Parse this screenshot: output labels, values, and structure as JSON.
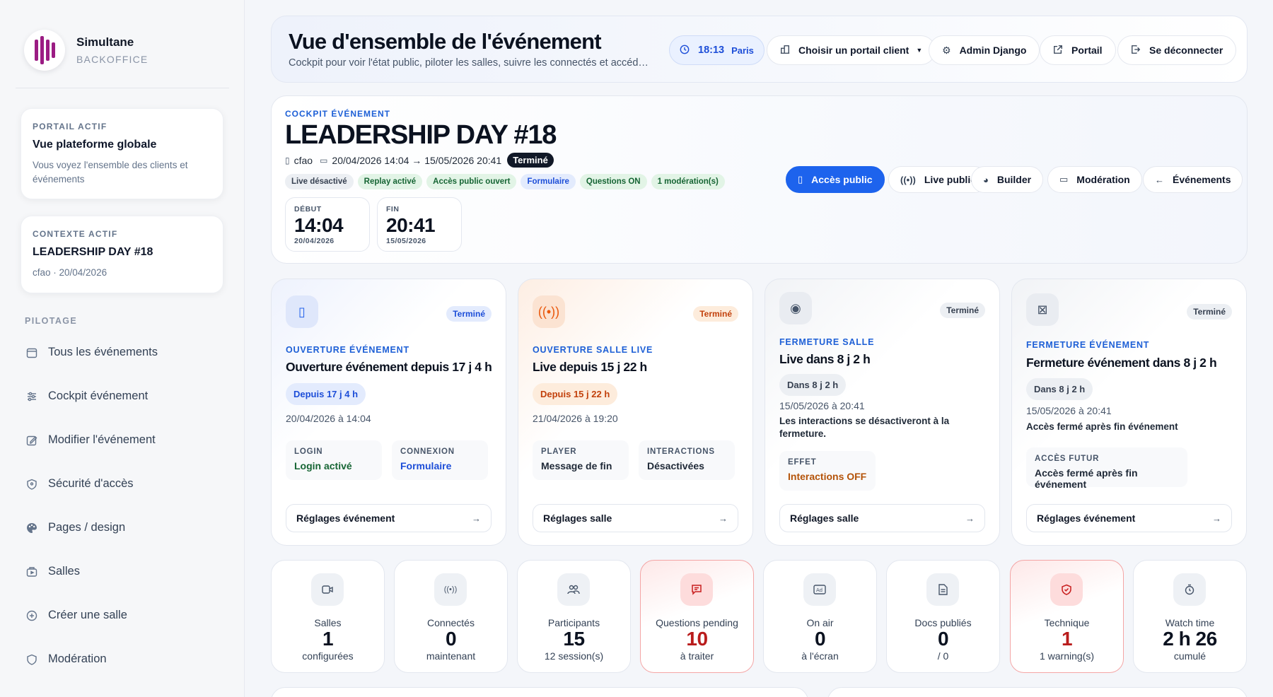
{
  "brand": {
    "name": "Simultane",
    "sub": "BACKOFFICE"
  },
  "portal_card": {
    "kicker": "PORTAIL ACTIF",
    "title": "Vue plateforme globale",
    "desc": "Vous voyez l'ensemble des clients et événements"
  },
  "context_card": {
    "kicker": "CONTEXTE ACTIF",
    "title": "LEADERSHIP DAY #18",
    "desc": "cfao · 20/04/2026"
  },
  "nav": {
    "heading": "PILOTAGE",
    "items": [
      {
        "label": "Tous les événements",
        "icon": "calendar-icon"
      },
      {
        "label": "Cockpit événement",
        "icon": "sliders-icon"
      },
      {
        "label": "Modifier l'événement",
        "icon": "edit-icon"
      },
      {
        "label": "Sécurité d'accès",
        "icon": "shield-icon"
      },
      {
        "label": "Pages / design",
        "icon": "palette-icon"
      },
      {
        "label": "Salles",
        "icon": "rooms-icon"
      },
      {
        "label": "Créer une salle",
        "icon": "plus-circle-icon"
      },
      {
        "label": "Modération",
        "icon": "shield-check-icon"
      }
    ]
  },
  "header": {
    "title": "Vue d'ensemble de l'événement",
    "subtitle": "Cockpit pour voir l'état public, piloter les salles, suivre les connectés et accéder aux réglages",
    "clock_time": "18:13",
    "clock_city": "Paris",
    "portal_select": "Choisir un portail client",
    "admin": "Admin Django",
    "portal": "Portail",
    "logout": "Se déconnecter"
  },
  "event": {
    "kicker": "COCKPIT ÉVÉNEMENT",
    "title": "LEADERSHIP DAY #18",
    "client": "cfao",
    "dates": "20/04/2026 14:04 → 15/05/2026 20:41",
    "status": "Terminé",
    "tags": [
      "Live désactivé",
      "Replay activé",
      "Accès public ouvert",
      "Formulaire",
      "Questions ON",
      "1 modération(s)"
    ],
    "start": {
      "label": "DÉBUT",
      "time": "14:04",
      "date": "20/04/2026"
    },
    "end": {
      "label": "FIN",
      "time": "20:41",
      "date": "15/05/2026"
    },
    "actions": [
      "Accès public",
      "Live public",
      "Builder",
      "Modération",
      "Événements"
    ]
  },
  "steps": [
    {
      "status": "Terminé",
      "kicker": "OUVERTURE ÉVÉNEMENT",
      "title": "Ouverture événement depuis 17 j 4 h",
      "pill": "Depuis 17 j 4 h",
      "date": "20/04/2026 à 14:04",
      "kv": [
        {
          "k": "LOGIN",
          "v": "Login activé"
        },
        {
          "k": "CONNEXION",
          "v": "Formulaire"
        }
      ],
      "button": "Réglages événement"
    },
    {
      "status": "Terminé",
      "kicker": "OUVERTURE SALLE LIVE",
      "title": "Live depuis 15 j 22 h",
      "pill": "Depuis 15 j 22 h",
      "date": "21/04/2026 à 19:20",
      "kv": [
        {
          "k": "PLAYER",
          "v": "Message de fin"
        },
        {
          "k": "INTERACTIONS",
          "v": "Désactivées"
        }
      ],
      "button": "Réglages salle"
    },
    {
      "status": "Terminé",
      "kicker": "FERMETURE SALLE",
      "title": "Live dans 8 j 2 h",
      "pill": "Dans 8 j 2 h",
      "date": "15/05/2026 à 20:41",
      "note": "Les interactions se désactiveront à la fermeture.",
      "kv": [
        {
          "k": "EFFET",
          "v": "Interactions OFF"
        }
      ],
      "button": "Réglages salle"
    },
    {
      "status": "Terminé",
      "kicker": "FERMETURE ÉVÉNEMENT",
      "title": "Fermeture événement dans 8 j 2 h",
      "pill": "Dans 8 j 2 h",
      "date": "15/05/2026 à 20:41",
      "note": "Accès fermé après fin événement",
      "kv": [
        {
          "k": "ACCÈS FUTUR",
          "v": "Accès fermé après fin événement"
        }
      ],
      "button": "Réglages événement"
    }
  ],
  "stats": [
    {
      "label": "Salles",
      "value": "1",
      "sub": "configurées",
      "icon": "video-icon"
    },
    {
      "label": "Connectés",
      "value": "0",
      "sub": "maintenant",
      "icon": "broadcast-icon"
    },
    {
      "label": "Participants",
      "value": "15",
      "sub": "12 session(s)",
      "icon": "users-icon"
    },
    {
      "label": "Questions pending",
      "value": "10",
      "sub": "à traiter",
      "icon": "message-icon"
    },
    {
      "label": "On air",
      "value": "0",
      "sub": "à l'écran",
      "icon": "ad-icon"
    },
    {
      "label": "Docs publiés",
      "value": "0",
      "sub": "/ 0",
      "icon": "document-icon"
    },
    {
      "label": "Technique",
      "value": "1",
      "sub": "1 warning(s)",
      "icon": "shield-alert-icon"
    },
    {
      "label": "Watch time",
      "value": "2 h 26",
      "sub": "cumulé",
      "icon": "stopwatch-icon"
    }
  ],
  "colors": {
    "accent": "#1d63ed",
    "brand": "#9b1c83",
    "alert": "#b91c1c"
  }
}
